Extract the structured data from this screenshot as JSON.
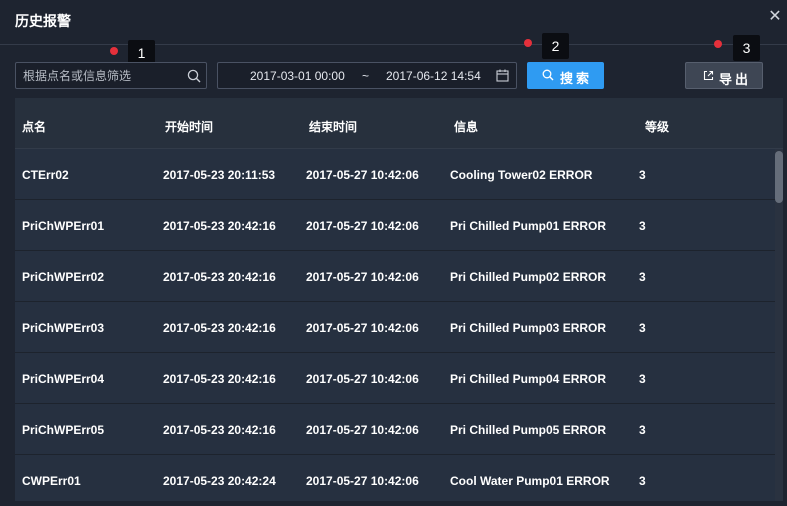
{
  "window": {
    "title": "历史报警",
    "close_icon": "close-icon"
  },
  "markers": [
    "1",
    "2",
    "3"
  ],
  "toolbar": {
    "search_placeholder": "根据点名或信息筛选",
    "date_start": "2017-03-01 00:00",
    "date_separator": "~",
    "date_end": "2017-06-12 14:54",
    "search_label": "搜索",
    "export_label": "导出"
  },
  "table": {
    "columns": [
      "点名",
      "开始时间",
      "结束时间",
      "信息",
      "等级"
    ],
    "rows": [
      [
        "CTErr02",
        "2017-05-23 20:11:53",
        "2017-05-27 10:42:06",
        "Cooling Tower02 ERROR",
        "3"
      ],
      [
        "PriChWPErr01",
        "2017-05-23 20:42:16",
        "2017-05-27 10:42:06",
        "Pri Chilled Pump01 ERROR",
        "3"
      ],
      [
        "PriChWPErr02",
        "2017-05-23 20:42:16",
        "2017-05-27 10:42:06",
        "Pri Chilled Pump02 ERROR",
        "3"
      ],
      [
        "PriChWPErr03",
        "2017-05-23 20:42:16",
        "2017-05-27 10:42:06",
        "Pri Chilled Pump03 ERROR",
        "3"
      ],
      [
        "PriChWPErr04",
        "2017-05-23 20:42:16",
        "2017-05-27 10:42:06",
        "Pri Chilled Pump04 ERROR",
        "3"
      ],
      [
        "PriChWPErr05",
        "2017-05-23 20:42:16",
        "2017-05-27 10:42:06",
        "Pri Chilled Pump05 ERROR",
        "3"
      ],
      [
        "CWPErr01",
        "2017-05-23 20:42:24",
        "2017-05-27 10:42:06",
        "Cool Water Pump01 ERROR",
        "3"
      ]
    ]
  },
  "colors": {
    "background": "#1e2430",
    "table_background": "#27303d",
    "accent": "#2f9bf2",
    "marker": "#e5303b"
  }
}
